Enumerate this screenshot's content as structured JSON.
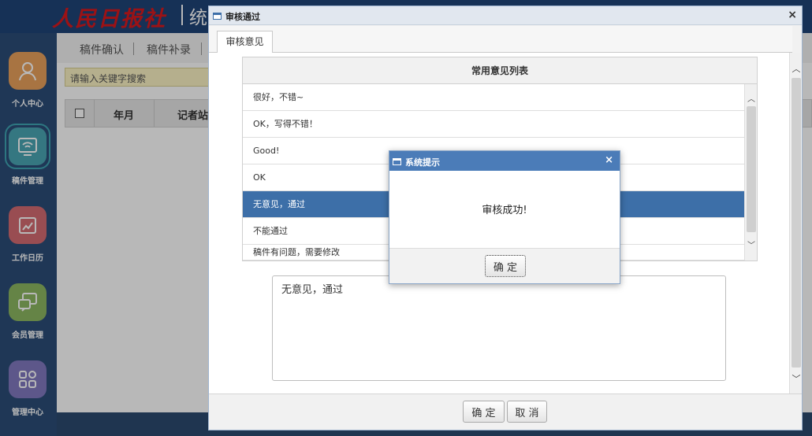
{
  "header": {
    "logo_text": "人民日报社",
    "title": "统"
  },
  "sidebar": {
    "items": [
      {
        "label": "个人中心",
        "icon": "user-icon",
        "color": "#e9a15c"
      },
      {
        "label": "稿件管理",
        "icon": "monitor-icon",
        "color": "#4aa6b3"
      },
      {
        "label": "工作日历",
        "icon": "calendar-edit-icon",
        "color": "#d56b72"
      },
      {
        "label": "会员管理",
        "icon": "chat-icon",
        "color": "#8db862"
      },
      {
        "label": "管理中心",
        "icon": "grid-icon",
        "color": "#8179bf"
      }
    ]
  },
  "main": {
    "tabs": [
      "稿件确认",
      "稿件补录"
    ],
    "search_placeholder": "请输入关键字搜索",
    "table_headers": [
      "年月",
      "记者站"
    ]
  },
  "review_dialog": {
    "title": "审核通过",
    "tab": "审核意见",
    "list_header": "常用意见列表",
    "opinions": [
      "很好，不错~",
      "OK，写得不错！",
      "Good!",
      "OK",
      "无意见，通过",
      "不能通过",
      "稿件有问题，需要修改"
    ],
    "selected_index": 4,
    "opinion_value": "无意见，通过",
    "confirm_label": "确 定",
    "cancel_label": "取 消"
  },
  "alert": {
    "title": "系统提示",
    "message": "审核成功!",
    "ok_label": "确 定"
  },
  "colors": {
    "selected_row": "#3d6fa8",
    "alert_title": "#4b7cb8",
    "topbar": "#1f4478"
  }
}
